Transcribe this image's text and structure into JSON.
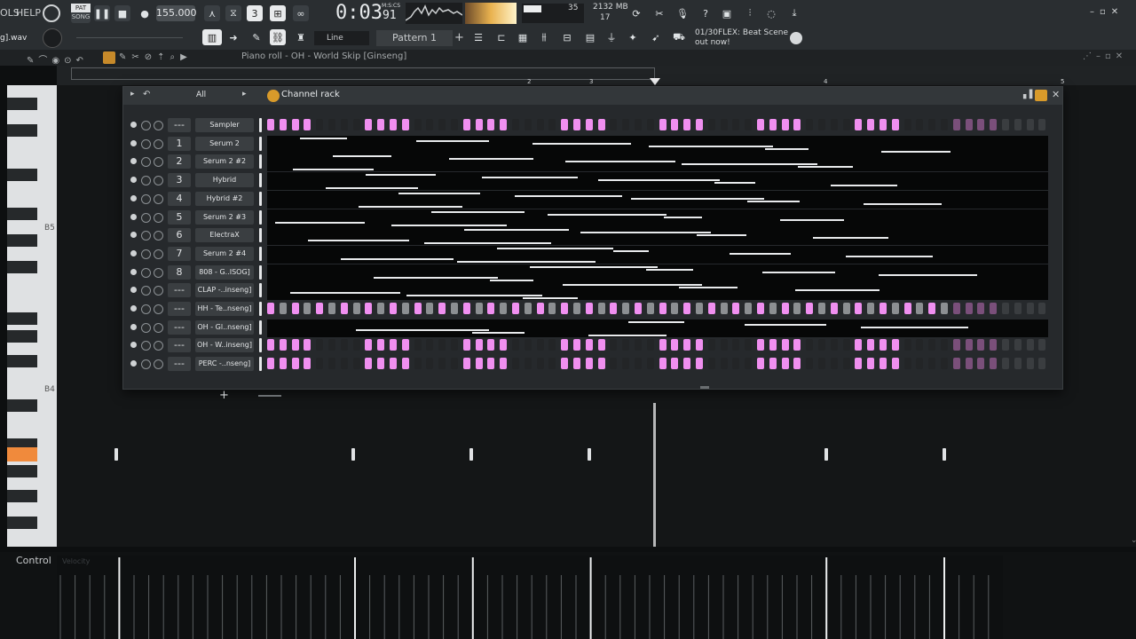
{
  "menu": {
    "items": [
      "OLS",
      "HELP"
    ],
    "pat_label": "PAT",
    "song_label": "SONG"
  },
  "transport": {
    "tempo": "155.000",
    "time_main": "0:03",
    "time_sub": "91",
    "time_label": "M:S:CS"
  },
  "cpu": {
    "memory": "2132 MB",
    "voices": "17",
    "poly": "35"
  },
  "hint": {
    "counter": "01/30",
    "text": "FLEX: Beat Scene",
    "text2": "out now!"
  },
  "file": {
    "name": "g].wav"
  },
  "snap": {
    "value": "Line"
  },
  "pattern": {
    "name": "Pattern 1",
    "add": "+"
  },
  "pianoroll": {
    "title": "Piano roll - OH - World Skip [Ginseng]",
    "key_labels": [
      "B5",
      "B4"
    ]
  },
  "timeline": {
    "marks": [
      "2",
      "3",
      "4",
      "5"
    ]
  },
  "rack": {
    "title": "Channel rack",
    "filter": "All",
    "channels": [
      {
        "num": "",
        "name": "Sampler",
        "type": "steps"
      },
      {
        "num": "1",
        "name": "Serum 2",
        "type": "pr"
      },
      {
        "num": "2",
        "name": "Serum 2 #2",
        "type": "pr"
      },
      {
        "num": "3",
        "name": "Hybrid",
        "type": "pr"
      },
      {
        "num": "4",
        "name": "Hybrid #2",
        "type": "pr"
      },
      {
        "num": "5",
        "name": "Serum 2 #3",
        "type": "pr"
      },
      {
        "num": "6",
        "name": "ElectraX",
        "type": "pr"
      },
      {
        "num": "7",
        "name": "Serum 2 #4",
        "type": "pr"
      },
      {
        "num": "8",
        "name": "808 - G..ISOG]",
        "type": "pr"
      },
      {
        "num": "",
        "name": "CLAP -..inseng]",
        "type": "pr"
      },
      {
        "num": "",
        "name": "HH - Te..nseng]",
        "type": "steps"
      },
      {
        "num": "",
        "name": "OH - Gl..nseng]",
        "type": "pr"
      },
      {
        "num": "",
        "name": "OH - W..inseng]",
        "type": "steps"
      },
      {
        "num": "",
        "name": "PERC -..nseng]",
        "type": "steps"
      }
    ]
  },
  "control": {
    "label": "Control",
    "placeholder": "Velocity"
  },
  "colors": {
    "step_on": "#f08ff0",
    "step_off": "#232527",
    "step_dim": "#8c8f92",
    "accent": "#f08a3c"
  }
}
